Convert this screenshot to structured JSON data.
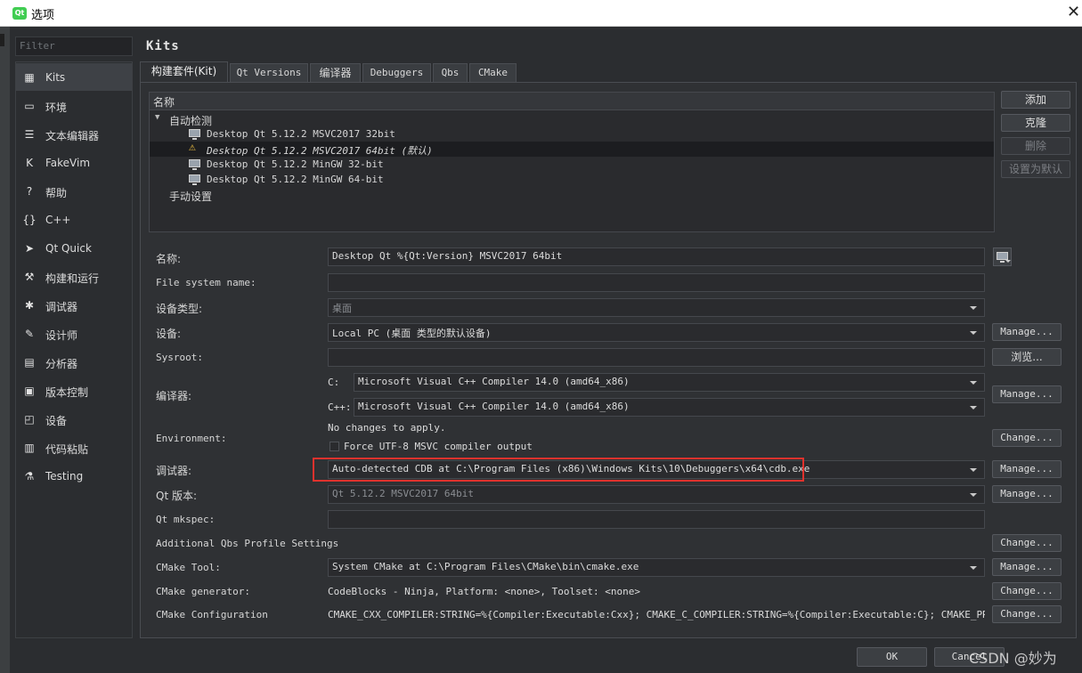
{
  "window": {
    "title": "选项",
    "logo": "Qt"
  },
  "filter": {
    "placeholder": "Filter"
  },
  "sidebar": {
    "items": [
      {
        "label": "Kits",
        "icon": "kits-icon",
        "glyph": "▦"
      },
      {
        "label": "环境",
        "icon": "monitor-icon",
        "glyph": "▭"
      },
      {
        "label": "文本编辑器",
        "icon": "text-editor-icon",
        "glyph": "☰"
      },
      {
        "label": "FakeVim",
        "icon": "fakevim-icon",
        "glyph": "K"
      },
      {
        "label": "帮助",
        "icon": "help-icon",
        "glyph": "?"
      },
      {
        "label": "C++",
        "icon": "cpp-braces-icon",
        "glyph": "{}"
      },
      {
        "label": "Qt Quick",
        "icon": "qt-quick-icon",
        "glyph": "➤"
      },
      {
        "label": "构建和运行",
        "icon": "hammer-icon",
        "glyph": "⚒"
      },
      {
        "label": "调试器",
        "icon": "bug-icon",
        "glyph": "✱"
      },
      {
        "label": "设计师",
        "icon": "pencil-icon",
        "glyph": "✎"
      },
      {
        "label": "分析器",
        "icon": "analyzer-icon",
        "glyph": "▤"
      },
      {
        "label": "版本控制",
        "icon": "version-control-icon",
        "glyph": "▣"
      },
      {
        "label": "设备",
        "icon": "device-icon",
        "glyph": "◰"
      },
      {
        "label": "代码粘贴",
        "icon": "code-paste-icon",
        "glyph": "▥"
      },
      {
        "label": "Testing",
        "icon": "testing-icon",
        "glyph": "⚗"
      }
    ]
  },
  "page": {
    "title": "Kits"
  },
  "tabs": [
    "构建套件(Kit)",
    "Qt Versions",
    "编译器",
    "Debuggers",
    "Qbs",
    "CMake"
  ],
  "tree": {
    "header": "名称",
    "auto_group": "自动检测",
    "kits": [
      {
        "name": "Desktop Qt 5.12.2 MSVC2017 32bit"
      },
      {
        "name": "Desktop Qt 5.12.2 MSVC2017 64bit (默认)"
      },
      {
        "name": "Desktop Qt 5.12.2 MinGW 32-bit"
      },
      {
        "name": "Desktop Qt 5.12.2 MinGW 64-bit"
      }
    ],
    "manual_group": "手动设置"
  },
  "side_buttons": {
    "add": "添加",
    "clone": "克隆",
    "remove": "删除",
    "default": "设置为默认"
  },
  "form": {
    "name_label": "名称:",
    "name_value": "Desktop Qt %{Qt:Version} MSVC2017 64bit",
    "fs_label": "File system name:",
    "fs_value": "",
    "device_type_label": "设备类型:",
    "device_type_value": "桌面",
    "device_label": "设备:",
    "device_value": "Local PC (桌面 类型的默认设备)",
    "sysroot_label": "Sysroot:",
    "sysroot_value": "",
    "compiler_label": "编译器:",
    "c_label": "C:",
    "c_value": "Microsoft Visual C++ Compiler 14.0 (amd64_x86)",
    "cpp_label": "C++:",
    "cpp_value": "Microsoft Visual C++ Compiler 14.0 (amd64_x86)",
    "env_label": "Environment:",
    "env_value": "No changes to apply.",
    "force_utf8": "Force UTF-8 MSVC compiler output",
    "debugger_label": "调试器:",
    "debugger_value": "Auto-detected CDB at C:\\Program Files (x86)\\Windows Kits\\10\\Debuggers\\x64\\cdb.exe",
    "qt_version_label": "Qt 版本:",
    "qt_version_value": "Qt 5.12.2 MSVC2017 64bit",
    "mkspec_label": "Qt mkspec:",
    "mkspec_value": "",
    "qbs_label": "Additional Qbs Profile Settings",
    "cmake_tool_label": "CMake Tool:",
    "cmake_tool_value": "System CMake at C:\\Program Files\\CMake\\bin\\cmake.exe",
    "cmake_gen_label": "CMake generator:",
    "cmake_gen_value": "CodeBlocks - Ninja, Platform: <none>, Toolset: <none>",
    "cmake_conf_label": "CMake Configuration",
    "cmake_conf_value": "CMAKE_CXX_COMPILER:STRING=%{Compiler:Executable:Cxx}; CMAKE_C_COMPILER:STRING=%{Compiler:Executable:C}; CMAKE_PREFIX_PATH…"
  },
  "buttons": {
    "manage": "Manage...",
    "browse": "浏览...",
    "change": "Change..."
  },
  "dialog": {
    "ok": "OK",
    "cancel": "Cancel"
  },
  "watermark": "CSDN @妙为",
  "colors": {
    "background": "#2b2d30",
    "highlight_border": "#e0322d",
    "warning": "#f0c040"
  }
}
